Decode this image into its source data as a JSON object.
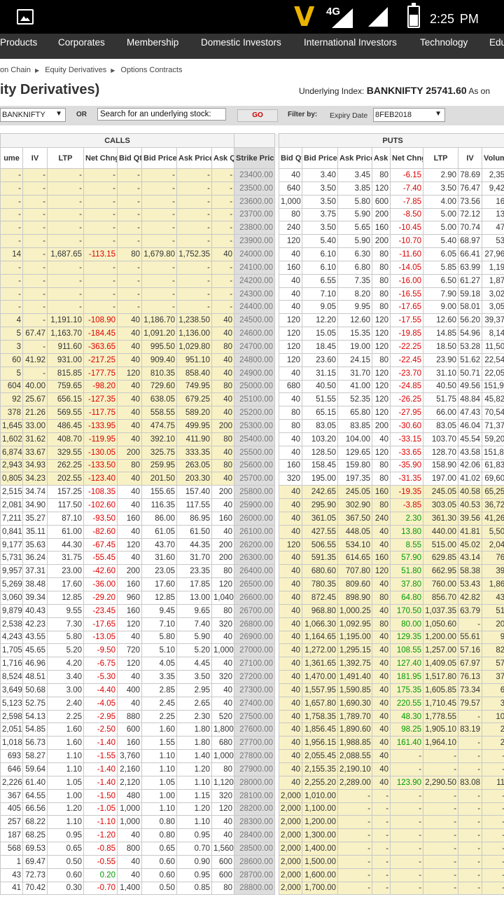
{
  "status_bar": {
    "network": "4G",
    "time": "2:25",
    "ampm": "PM",
    "icons": [
      "image-icon",
      "carrier-v-icon",
      "signal-icon",
      "battery-icon"
    ]
  },
  "nav": [
    "Products",
    "Corporates",
    "Membership",
    "Domestic Investors",
    "International Investors",
    "Technology",
    "Edu"
  ],
  "breadcrumb": [
    "on Chain",
    "Equity Derivatives",
    "Options Contracts"
  ],
  "page_title": "ity Derivatives)",
  "underlying": {
    "label": "Underlying Index:",
    "value": "BANKNIFTY 25741.60",
    "suffix": "As on"
  },
  "filters": {
    "symbol": "BANKNIFTY",
    "or": "OR",
    "search_value": "Search for an underlying stock:",
    "go": "GO",
    "filter_by": "Filter by:",
    "expiry_label": "Expiry Date",
    "expiry_value": "8FEB2018"
  },
  "colors": {
    "itm": "#f7f1c5",
    "strike_bg": "#dddddd",
    "negative": "#dd0000",
    "positive": "#009900",
    "nav_bg": "#333333"
  },
  "table": {
    "group_calls": "CALLS",
    "group_puts": "PUTS",
    "columns": [
      "ume",
      "IV",
      "LTP",
      "Net Chng",
      "Bid Qty",
      "Bid Price",
      "Ask Price",
      "Ask Qty",
      "Strike Price",
      "Bid Qty",
      "Bid Price",
      "Ask Price",
      "Ask Qty",
      "Net Chng",
      "LTP",
      "IV",
      "Volum"
    ],
    "rows": [
      [
        "-",
        "-",
        "-",
        "-",
        "-",
        "-",
        "-",
        "-",
        "23400.00",
        "40",
        "3.40",
        "3.45",
        "80",
        "-6.15",
        "2.90",
        "78.69",
        "2,35"
      ],
      [
        "-",
        "-",
        "-",
        "-",
        "-",
        "-",
        "-",
        "-",
        "23500.00",
        "640",
        "3.50",
        "3.85",
        "120",
        "-7.40",
        "3.50",
        "76.47",
        "9,42"
      ],
      [
        "-",
        "-",
        "-",
        "-",
        "-",
        "-",
        "-",
        "-",
        "23600.00",
        "1,000",
        "3.50",
        "5.80",
        "600",
        "-7.85",
        "4.00",
        "73.56",
        "16"
      ],
      [
        "-",
        "-",
        "-",
        "-",
        "-",
        "-",
        "-",
        "-",
        "23700.00",
        "80",
        "3.75",
        "5.90",
        "200",
        "-8.50",
        "5.00",
        "72.12",
        "13"
      ],
      [
        "-",
        "-",
        "-",
        "-",
        "-",
        "-",
        "-",
        "-",
        "23800.00",
        "240",
        "3.50",
        "5.65",
        "160",
        "-10.45",
        "5.00",
        "70.74",
        "47"
      ],
      [
        "-",
        "-",
        "-",
        "-",
        "-",
        "-",
        "-",
        "-",
        "23900.00",
        "120",
        "5.40",
        "5.90",
        "200",
        "-10.70",
        "5.40",
        "68.97",
        "53"
      ],
      [
        "14",
        "-",
        "1,687.65",
        "-113.15",
        "80",
        "1,679.80",
        "1,752.35",
        "40",
        "24000.00",
        "40",
        "6.10",
        "6.30",
        "80",
        "-11.60",
        "6.05",
        "66.41",
        "27,96"
      ],
      [
        "-",
        "-",
        "-",
        "-",
        "-",
        "-",
        "-",
        "-",
        "24100.00",
        "160",
        "6.10",
        "6.80",
        "80",
        "-14.05",
        "5.85",
        "63.99",
        "1,19"
      ],
      [
        "-",
        "-",
        "-",
        "-",
        "-",
        "-",
        "-",
        "-",
        "24200.00",
        "40",
        "6.55",
        "7.35",
        "80",
        "-16.00",
        "6.50",
        "61.27",
        "1,87"
      ],
      [
        "-",
        "-",
        "-",
        "-",
        "-",
        "-",
        "-",
        "-",
        "24300.00",
        "40",
        "7.10",
        "8.20",
        "80",
        "-16.55",
        "7.90",
        "59.18",
        "3,02"
      ],
      [
        "-",
        "-",
        "-",
        "-",
        "-",
        "-",
        "-",
        "-",
        "24400.00",
        "40",
        "9.05",
        "9.95",
        "80",
        "-17.65",
        "9.00",
        "58.01",
        "3,05"
      ],
      [
        "4",
        "-",
        "1,191.10",
        "-108.90",
        "40",
        "1,186.70",
        "1,238.50",
        "40",
        "24500.00",
        "120",
        "12.20",
        "12.60",
        "120",
        "-17.55",
        "12.60",
        "56.20",
        "39,37"
      ],
      [
        "5",
        "67.47",
        "1,163.70",
        "-184.45",
        "40",
        "1,091.20",
        "1,136.00",
        "40",
        "24600.00",
        "120",
        "15.05",
        "15.35",
        "120",
        "-19.85",
        "14.85",
        "54.96",
        "8,14"
      ],
      [
        "3",
        "-",
        "911.60",
        "-363.65",
        "40",
        "995.50",
        "1,029.80",
        "80",
        "24700.00",
        "120",
        "18.45",
        "19.00",
        "120",
        "-22.25",
        "18.50",
        "53.28",
        "11,50"
      ],
      [
        "60",
        "41.92",
        "931.00",
        "-217.25",
        "40",
        "909.40",
        "951.10",
        "40",
        "24800.00",
        "120",
        "23.60",
        "24.15",
        "80",
        "-22.45",
        "23.90",
        "51.62",
        "22,54"
      ],
      [
        "5",
        "-",
        "815.85",
        "-177.75",
        "120",
        "810.35",
        "858.40",
        "40",
        "24900.00",
        "40",
        "31.15",
        "31.70",
        "120",
        "-23.70",
        "31.10",
        "50.71",
        "22,05"
      ],
      [
        "604",
        "40.00",
        "759.65",
        "-98.20",
        "40",
        "729.60",
        "749.95",
        "80",
        "25000.00",
        "680",
        "40.50",
        "41.00",
        "120",
        "-24.85",
        "40.50",
        "49.56",
        "151,98"
      ],
      [
        "92",
        "25.67",
        "656.15",
        "-127.35",
        "40",
        "638.05",
        "679.25",
        "40",
        "25100.00",
        "40",
        "51.55",
        "52.35",
        "120",
        "-26.25",
        "51.75",
        "48.84",
        "45,82"
      ],
      [
        "378",
        "21.26",
        "569.55",
        "-117.75",
        "40",
        "558.55",
        "589.20",
        "40",
        "25200.00",
        "80",
        "65.15",
        "65.80",
        "120",
        "-27.95",
        "66.00",
        "47.43",
        "70,54"
      ],
      [
        "1,645",
        "33.00",
        "486.45",
        "-133.95",
        "40",
        "474.75",
        "499.95",
        "200",
        "25300.00",
        "80",
        "83.05",
        "83.85",
        "200",
        "-30.60",
        "83.05",
        "46.04",
        "71,37"
      ],
      [
        "1,602",
        "31.62",
        "408.70",
        "-119.95",
        "40",
        "392.10",
        "411.90",
        "80",
        "25400.00",
        "40",
        "103.20",
        "104.00",
        "40",
        "-33.15",
        "103.70",
        "45.54",
        "59,20"
      ],
      [
        "6,874",
        "33.67",
        "329.55",
        "-130.05",
        "200",
        "325.75",
        "333.35",
        "40",
        "25500.00",
        "40",
        "128.50",
        "129.65",
        "120",
        "-33.65",
        "128.70",
        "43.58",
        "151,88"
      ],
      [
        "2,943",
        "34.93",
        "262.25",
        "-133.50",
        "80",
        "259.95",
        "263.05",
        "80",
        "25600.00",
        "160",
        "158.45",
        "159.80",
        "80",
        "-35.90",
        "158.90",
        "42.06",
        "61,83"
      ],
      [
        "0,805",
        "34.23",
        "202.55",
        "-123.40",
        "40",
        "201.50",
        "203.30",
        "40",
        "25700.00",
        "320",
        "195.00",
        "197.35",
        "80",
        "-31.35",
        "197.00",
        "41.02",
        "69,60"
      ],
      [
        "2,515",
        "34.74",
        "157.25",
        "-108.35",
        "40",
        "155.65",
        "157.40",
        "200",
        "25800.00",
        "40",
        "242.65",
        "245.05",
        "160",
        "-19.35",
        "245.05",
        "40.58",
        "65,25"
      ],
      [
        "2,081",
        "34.90",
        "117.50",
        "-102.60",
        "40",
        "116.35",
        "117.55",
        "40",
        "25900.00",
        "40",
        "295.90",
        "302.90",
        "80",
        "-3.85",
        "303.05",
        "40.53",
        "36,72"
      ],
      [
        "7,211",
        "35.27",
        "87.10",
        "-93.50",
        "160",
        "86.00",
        "86.95",
        "160",
        "26000.00",
        "40",
        "361.05",
        "367.50",
        "240",
        "2.30",
        "361.30",
        "39.56",
        "41,26"
      ],
      [
        "0,841",
        "35.11",
        "61.00",
        "-82.60",
        "40",
        "61.05",
        "61.50",
        "40",
        "26100.00",
        "40",
        "427.55",
        "448.05",
        "40",
        "13.80",
        "440.00",
        "41.81",
        "5,50"
      ],
      [
        "9,177",
        "35.63",
        "44.30",
        "-67.45",
        "120",
        "43.70",
        "44.35",
        "200",
        "26200.00",
        "120",
        "506.55",
        "534.10",
        "40",
        "8.55",
        "515.00",
        "45.02",
        "2,04"
      ],
      [
        "5,731",
        "36.24",
        "31.75",
        "-55.45",
        "40",
        "31.60",
        "31.70",
        "200",
        "26300.00",
        "40",
        "591.35",
        "614.65",
        "160",
        "57.90",
        "629.85",
        "43.14",
        "76"
      ],
      [
        "9,957",
        "37.31",
        "23.00",
        "-42.60",
        "200",
        "23.05",
        "23.35",
        "80",
        "26400.00",
        "40",
        "680.60",
        "707.80",
        "120",
        "51.80",
        "662.95",
        "58.38",
        "39"
      ],
      [
        "5,269",
        "38.48",
        "17.60",
        "-36.00",
        "160",
        "17.60",
        "17.85",
        "120",
        "26500.00",
        "40",
        "780.35",
        "809.60",
        "40",
        "37.80",
        "760.00",
        "53.43",
        "1,86"
      ],
      [
        "3,060",
        "39.34",
        "12.85",
        "-29.20",
        "960",
        "12.85",
        "13.00",
        "1,040",
        "26600.00",
        "40",
        "872.45",
        "898.90",
        "80",
        "64.80",
        "856.70",
        "42.82",
        "43"
      ],
      [
        "9,879",
        "40.43",
        "9.55",
        "-23.45",
        "160",
        "9.45",
        "9.65",
        "80",
        "26700.00",
        "40",
        "968.80",
        "1,000.25",
        "40",
        "170.50",
        "1,037.35",
        "63.79",
        "51"
      ],
      [
        "2,538",
        "42.23",
        "7.30",
        "-17.65",
        "120",
        "7.10",
        "7.40",
        "320",
        "26800.00",
        "40",
        "1,066.30",
        "1,092.95",
        "80",
        "80.00",
        "1,050.60",
        "-",
        "20"
      ],
      [
        "4,243",
        "43.55",
        "5.80",
        "-13.05",
        "40",
        "5.80",
        "5.90",
        "40",
        "26900.00",
        "40",
        "1,164.65",
        "1,195.00",
        "40",
        "129.35",
        "1,200.00",
        "55.61",
        "9"
      ],
      [
        "1,705",
        "45.65",
        "5.20",
        "-9.50",
        "720",
        "5.10",
        "5.20",
        "1,000",
        "27000.00",
        "40",
        "1,272.00",
        "1,295.15",
        "40",
        "108.55",
        "1,257.00",
        "57.16",
        "82"
      ],
      [
        "1,716",
        "46.96",
        "4.20",
        "-6.75",
        "120",
        "4.05",
        "4.45",
        "40",
        "27100.00",
        "40",
        "1,361.65",
        "1,392.75",
        "40",
        "127.40",
        "1,409.05",
        "67.97",
        "57"
      ],
      [
        "8,524",
        "48.51",
        "3.40",
        "-5.30",
        "40",
        "3.35",
        "3.50",
        "320",
        "27200.00",
        "40",
        "1,470.00",
        "1,491.40",
        "40",
        "181.95",
        "1,517.80",
        "76.13",
        "37"
      ],
      [
        "3,649",
        "50.68",
        "3.00",
        "-4.40",
        "400",
        "2.85",
        "2.95",
        "40",
        "27300.00",
        "40",
        "1,557.95",
        "1,590.85",
        "40",
        "175.35",
        "1,605.85",
        "73.34",
        "6"
      ],
      [
        "5,123",
        "52.75",
        "2.40",
        "-4.05",
        "40",
        "2.45",
        "2.65",
        "40",
        "27400.00",
        "40",
        "1,657.80",
        "1,690.30",
        "40",
        "220.55",
        "1,710.45",
        "79.57",
        "3"
      ],
      [
        "2,598",
        "54.13",
        "2.25",
        "-2.95",
        "880",
        "2.25",
        "2.30",
        "520",
        "27500.00",
        "40",
        "1,758.35",
        "1,789.70",
        "40",
        "48.30",
        "1,778.55",
        "-",
        "10"
      ],
      [
        "2,051",
        "54.85",
        "1.60",
        "-2.50",
        "600",
        "1.60",
        "1.80",
        "1,800",
        "27600.00",
        "40",
        "1,856.45",
        "1,890.60",
        "40",
        "98.25",
        "1,905.10",
        "83.19",
        "2"
      ],
      [
        "1,018",
        "56.73",
        "1.60",
        "-1.40",
        "160",
        "1.55",
        "1.80",
        "680",
        "27700.00",
        "40",
        "1,956.15",
        "1,988.85",
        "40",
        "161.40",
        "1,964.10",
        "-",
        "2"
      ],
      [
        "693",
        "58.27",
        "1.10",
        "-1.55",
        "3,760",
        "1.10",
        "1.40",
        "1,000",
        "27800.00",
        "40",
        "2,055.45",
        "2,088.55",
        "40",
        "-",
        "-",
        "-",
        "-"
      ],
      [
        "646",
        "59.64",
        "1.10",
        "-1.40",
        "2,160",
        "1.10",
        "1.20",
        "80",
        "27900.00",
        "40",
        "2,155.35",
        "2,190.10",
        "40",
        "-",
        "-",
        "-",
        "-"
      ],
      [
        "2,226",
        "61.40",
        "1.05",
        "-1.40",
        "2,120",
        "1.05",
        "1.10",
        "1,120",
        "28000.00",
        "40",
        "2,255.20",
        "2,289.00",
        "40",
        "123.90",
        "2,290.50",
        "83.08",
        "11"
      ],
      [
        "367",
        "64.55",
        "1.00",
        "-1.50",
        "480",
        "1.00",
        "1.15",
        "320",
        "28100.00",
        "2,000",
        "1,010.00",
        "-",
        "-",
        "-",
        "-",
        "-",
        "-"
      ],
      [
        "405",
        "66.56",
        "1.20",
        "-1.05",
        "1,000",
        "1.10",
        "1.20",
        "120",
        "28200.00",
        "2,000",
        "1,100.00",
        "-",
        "-",
        "-",
        "-",
        "-",
        "-"
      ],
      [
        "257",
        "68.22",
        "1.10",
        "-1.10",
        "1,000",
        "0.80",
        "1.10",
        "40",
        "28300.00",
        "2,000",
        "1,200.00",
        "-",
        "-",
        "-",
        "-",
        "-",
        "-"
      ],
      [
        "187",
        "68.25",
        "0.95",
        "-1.20",
        "40",
        "0.80",
        "0.95",
        "40",
        "28400.00",
        "2,000",
        "1,300.00",
        "-",
        "-",
        "-",
        "-",
        "-",
        "-"
      ],
      [
        "568",
        "69.53",
        "0.65",
        "-0.85",
        "800",
        "0.65",
        "0.70",
        "1,560",
        "28500.00",
        "2,000",
        "1,400.00",
        "-",
        "-",
        "-",
        "-",
        "-",
        "-"
      ],
      [
        "1",
        "69.47",
        "0.50",
        "-0.55",
        "40",
        "0.60",
        "0.90",
        "600",
        "28600.00",
        "2,000",
        "1,500.00",
        "-",
        "-",
        "-",
        "-",
        "-",
        "-"
      ],
      [
        "43",
        "72.73",
        "0.60",
        "0.20",
        "40",
        "0.60",
        "0.95",
        "600",
        "28700.00",
        "2,000",
        "1,600.00",
        "-",
        "-",
        "-",
        "-",
        "-",
        "-"
      ],
      [
        "41",
        "70.42",
        "0.30",
        "-0.70",
        "1,400",
        "0.50",
        "0.85",
        "80",
        "28800.00",
        "2,000",
        "1,700.00",
        "-",
        "-",
        "-",
        "-",
        "-",
        "-"
      ]
    ]
  }
}
